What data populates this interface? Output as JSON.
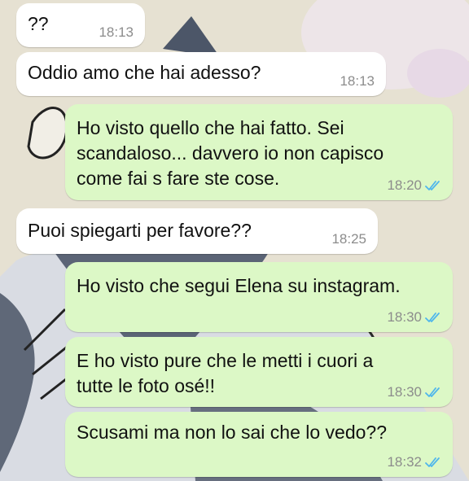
{
  "messages": [
    {
      "dir": "in",
      "lines": [
        "??"
      ],
      "time": "18:13",
      "read": false
    },
    {
      "dir": "in",
      "lines": [
        "Oddio amo che hai adesso?"
      ],
      "time": "18:13",
      "read": false
    },
    {
      "dir": "out",
      "lines": [
        "Ho visto quello che hai fatto. Sei",
        "scandaloso... davvero io non capisco",
        "come fai s fare ste cose."
      ],
      "time": "18:20",
      "read": true
    },
    {
      "dir": "in",
      "lines": [
        "Puoi spiegarti per favore??"
      ],
      "time": "18:25",
      "read": false
    },
    {
      "dir": "out",
      "lines": [
        "Ho visto che segui Elena su instagram."
      ],
      "time": "18:30",
      "read": true
    },
    {
      "dir": "out",
      "lines": [
        "E ho visto pure che le metti i cuori a",
        "tutte le foto osé!!"
      ],
      "time": "18:30",
      "read": true
    },
    {
      "dir": "out",
      "lines": [
        "Scusami ma non lo sai che lo vedo??"
      ],
      "time": "18:32",
      "read": true
    }
  ],
  "colors": {
    "incoming_bubble": "#ffffff",
    "outgoing_bubble": "#dcf8c6",
    "read_ticks": "#4fb6ec",
    "timestamp": "#8c8c8c"
  },
  "icons": {
    "read_receipt": "double-check-icon"
  }
}
